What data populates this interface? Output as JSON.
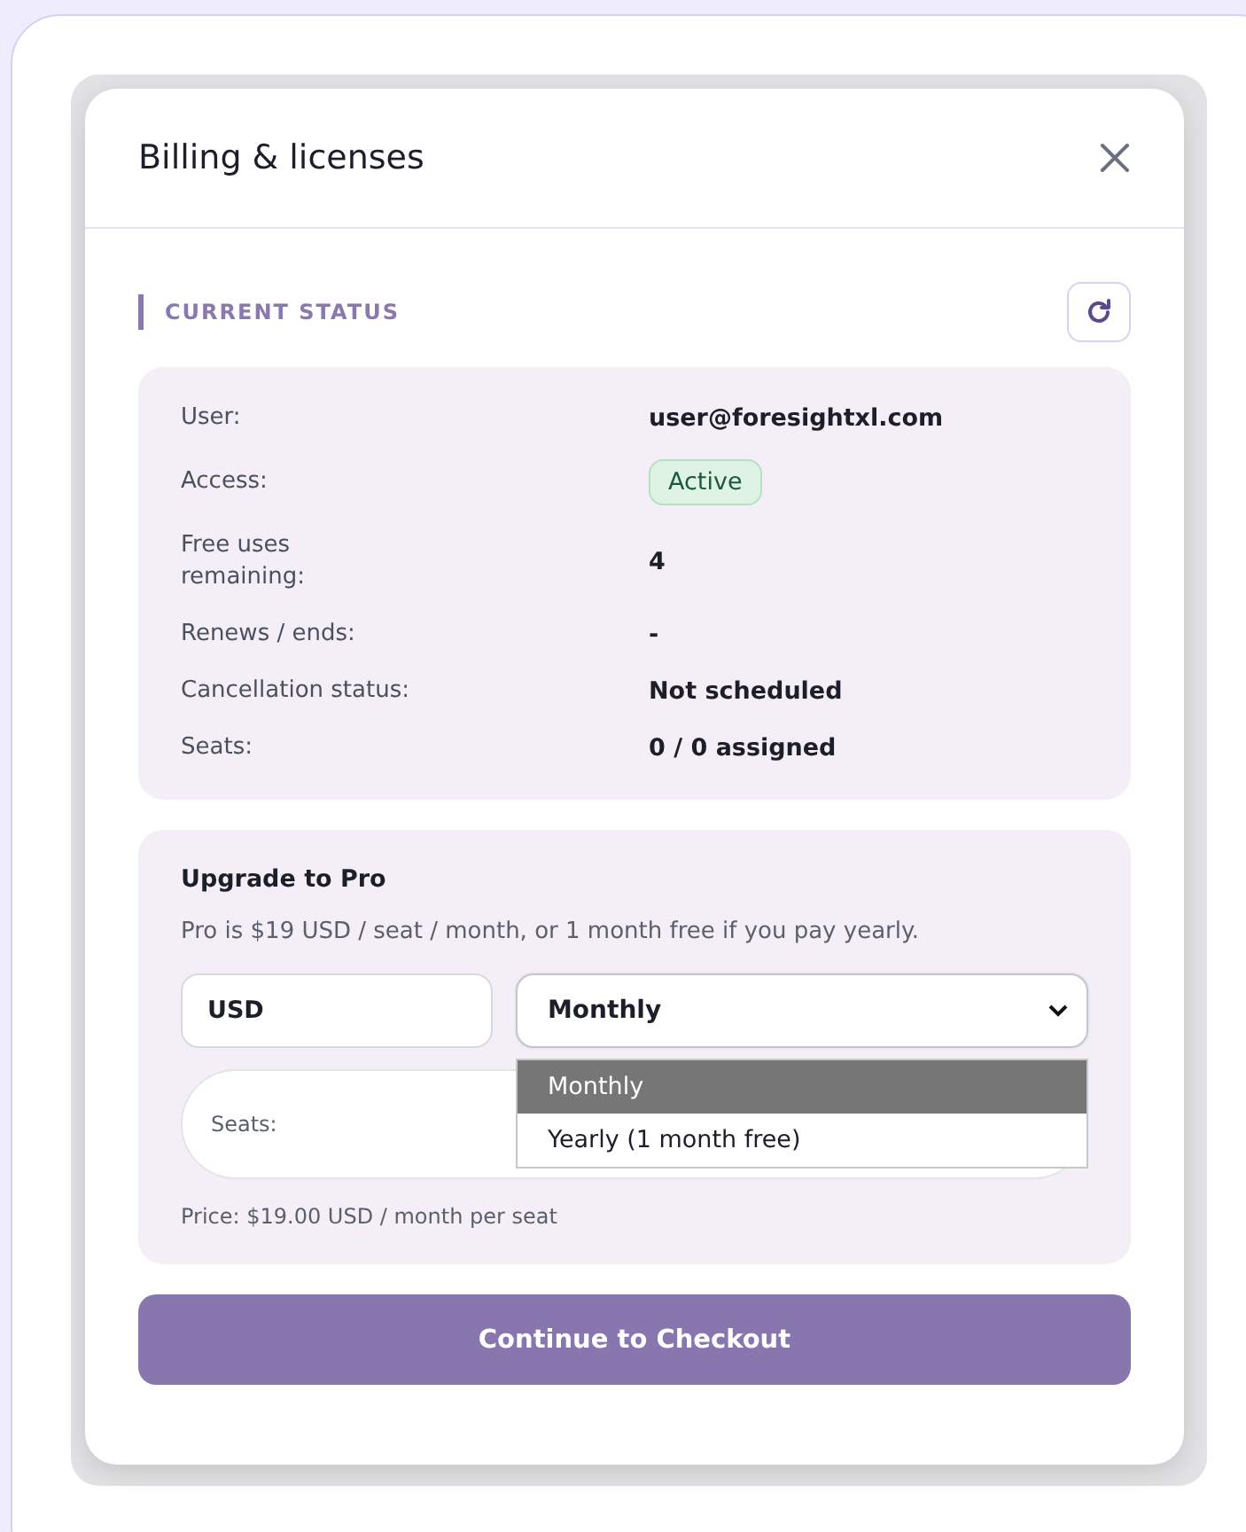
{
  "dialog": {
    "title": "Billing & licenses"
  },
  "status": {
    "heading": "CURRENT STATUS",
    "rows": [
      {
        "label": "User:",
        "value": "user@foresightxl.com",
        "kind": "text"
      },
      {
        "label": "Access:",
        "value": "Active",
        "kind": "badge"
      },
      {
        "label": "Free uses remaining:",
        "value": "4",
        "kind": "text"
      },
      {
        "label": "Renews / ends:",
        "value": "-",
        "kind": "text"
      },
      {
        "label": "Cancellation status:",
        "value": "Not scheduled",
        "kind": "text"
      },
      {
        "label": "Seats:",
        "value": "0 / 0 assigned",
        "kind": "text"
      }
    ]
  },
  "upgrade": {
    "title": "Upgrade to Pro",
    "description": "Pro is $19 USD / seat / month, or 1 month free if you pay yearly.",
    "currency": {
      "value": "USD"
    },
    "period": {
      "value": "Monthly",
      "expanded": true,
      "options": [
        {
          "label": "Monthly",
          "selected": true
        },
        {
          "label": "Yearly (1 month free)",
          "selected": false
        }
      ]
    },
    "seats": {
      "label": "Seats:"
    },
    "price": "Price: $19.00 USD / month per seat"
  },
  "checkout_button": "Continue to Checkout"
}
